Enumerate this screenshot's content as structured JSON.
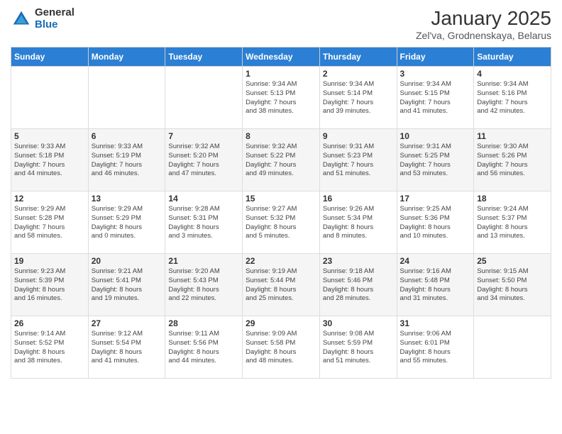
{
  "logo": {
    "general": "General",
    "blue": "Blue"
  },
  "title": "January 2025",
  "subtitle": "Zel'va, Grodnenskaya, Belarus",
  "days_of_week": [
    "Sunday",
    "Monday",
    "Tuesday",
    "Wednesday",
    "Thursday",
    "Friday",
    "Saturday"
  ],
  "weeks": [
    [
      {
        "day": "",
        "info": ""
      },
      {
        "day": "",
        "info": ""
      },
      {
        "day": "",
        "info": ""
      },
      {
        "day": "1",
        "info": "Sunrise: 9:34 AM\nSunset: 5:13 PM\nDaylight: 7 hours\nand 38 minutes."
      },
      {
        "day": "2",
        "info": "Sunrise: 9:34 AM\nSunset: 5:14 PM\nDaylight: 7 hours\nand 39 minutes."
      },
      {
        "day": "3",
        "info": "Sunrise: 9:34 AM\nSunset: 5:15 PM\nDaylight: 7 hours\nand 41 minutes."
      },
      {
        "day": "4",
        "info": "Sunrise: 9:34 AM\nSunset: 5:16 PM\nDaylight: 7 hours\nand 42 minutes."
      }
    ],
    [
      {
        "day": "5",
        "info": "Sunrise: 9:33 AM\nSunset: 5:18 PM\nDaylight: 7 hours\nand 44 minutes."
      },
      {
        "day": "6",
        "info": "Sunrise: 9:33 AM\nSunset: 5:19 PM\nDaylight: 7 hours\nand 46 minutes."
      },
      {
        "day": "7",
        "info": "Sunrise: 9:32 AM\nSunset: 5:20 PM\nDaylight: 7 hours\nand 47 minutes."
      },
      {
        "day": "8",
        "info": "Sunrise: 9:32 AM\nSunset: 5:22 PM\nDaylight: 7 hours\nand 49 minutes."
      },
      {
        "day": "9",
        "info": "Sunrise: 9:31 AM\nSunset: 5:23 PM\nDaylight: 7 hours\nand 51 minutes."
      },
      {
        "day": "10",
        "info": "Sunrise: 9:31 AM\nSunset: 5:25 PM\nDaylight: 7 hours\nand 53 minutes."
      },
      {
        "day": "11",
        "info": "Sunrise: 9:30 AM\nSunset: 5:26 PM\nDaylight: 7 hours\nand 56 minutes."
      }
    ],
    [
      {
        "day": "12",
        "info": "Sunrise: 9:29 AM\nSunset: 5:28 PM\nDaylight: 7 hours\nand 58 minutes."
      },
      {
        "day": "13",
        "info": "Sunrise: 9:29 AM\nSunset: 5:29 PM\nDaylight: 8 hours\nand 0 minutes."
      },
      {
        "day": "14",
        "info": "Sunrise: 9:28 AM\nSunset: 5:31 PM\nDaylight: 8 hours\nand 3 minutes."
      },
      {
        "day": "15",
        "info": "Sunrise: 9:27 AM\nSunset: 5:32 PM\nDaylight: 8 hours\nand 5 minutes."
      },
      {
        "day": "16",
        "info": "Sunrise: 9:26 AM\nSunset: 5:34 PM\nDaylight: 8 hours\nand 8 minutes."
      },
      {
        "day": "17",
        "info": "Sunrise: 9:25 AM\nSunset: 5:36 PM\nDaylight: 8 hours\nand 10 minutes."
      },
      {
        "day": "18",
        "info": "Sunrise: 9:24 AM\nSunset: 5:37 PM\nDaylight: 8 hours\nand 13 minutes."
      }
    ],
    [
      {
        "day": "19",
        "info": "Sunrise: 9:23 AM\nSunset: 5:39 PM\nDaylight: 8 hours\nand 16 minutes."
      },
      {
        "day": "20",
        "info": "Sunrise: 9:21 AM\nSunset: 5:41 PM\nDaylight: 8 hours\nand 19 minutes."
      },
      {
        "day": "21",
        "info": "Sunrise: 9:20 AM\nSunset: 5:43 PM\nDaylight: 8 hours\nand 22 minutes."
      },
      {
        "day": "22",
        "info": "Sunrise: 9:19 AM\nSunset: 5:44 PM\nDaylight: 8 hours\nand 25 minutes."
      },
      {
        "day": "23",
        "info": "Sunrise: 9:18 AM\nSunset: 5:46 PM\nDaylight: 8 hours\nand 28 minutes."
      },
      {
        "day": "24",
        "info": "Sunrise: 9:16 AM\nSunset: 5:48 PM\nDaylight: 8 hours\nand 31 minutes."
      },
      {
        "day": "25",
        "info": "Sunrise: 9:15 AM\nSunset: 5:50 PM\nDaylight: 8 hours\nand 34 minutes."
      }
    ],
    [
      {
        "day": "26",
        "info": "Sunrise: 9:14 AM\nSunset: 5:52 PM\nDaylight: 8 hours\nand 38 minutes."
      },
      {
        "day": "27",
        "info": "Sunrise: 9:12 AM\nSunset: 5:54 PM\nDaylight: 8 hours\nand 41 minutes."
      },
      {
        "day": "28",
        "info": "Sunrise: 9:11 AM\nSunset: 5:56 PM\nDaylight: 8 hours\nand 44 minutes."
      },
      {
        "day": "29",
        "info": "Sunrise: 9:09 AM\nSunset: 5:58 PM\nDaylight: 8 hours\nand 48 minutes."
      },
      {
        "day": "30",
        "info": "Sunrise: 9:08 AM\nSunset: 5:59 PM\nDaylight: 8 hours\nand 51 minutes."
      },
      {
        "day": "31",
        "info": "Sunrise: 9:06 AM\nSunset: 6:01 PM\nDaylight: 8 hours\nand 55 minutes."
      },
      {
        "day": "",
        "info": ""
      }
    ]
  ]
}
